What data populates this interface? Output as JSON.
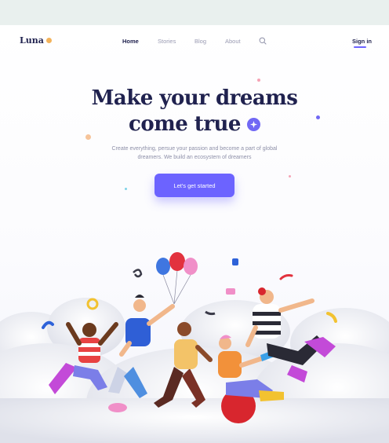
{
  "nav": {
    "logo": "Luna",
    "links": [
      {
        "label": "Home",
        "active": true
      },
      {
        "label": "Stories",
        "active": false
      },
      {
        "label": "Blog",
        "active": false
      },
      {
        "label": "About",
        "active": false
      }
    ],
    "search_icon": "search-icon",
    "signin": "Sign in"
  },
  "hero": {
    "title_line1": "Make your dreams",
    "title_line2": "come true",
    "sparkle_icon": "sparkle-icon",
    "subtitle": "Create everything, persue your passion and become a part of global dreamers. We build an ecosystem of dreamers",
    "cta": "Let's get started"
  },
  "colors": {
    "accent": "#6c63ff",
    "navy": "#20224f",
    "muted": "#8e90a8",
    "outer_bg": "#e9f0ee"
  }
}
